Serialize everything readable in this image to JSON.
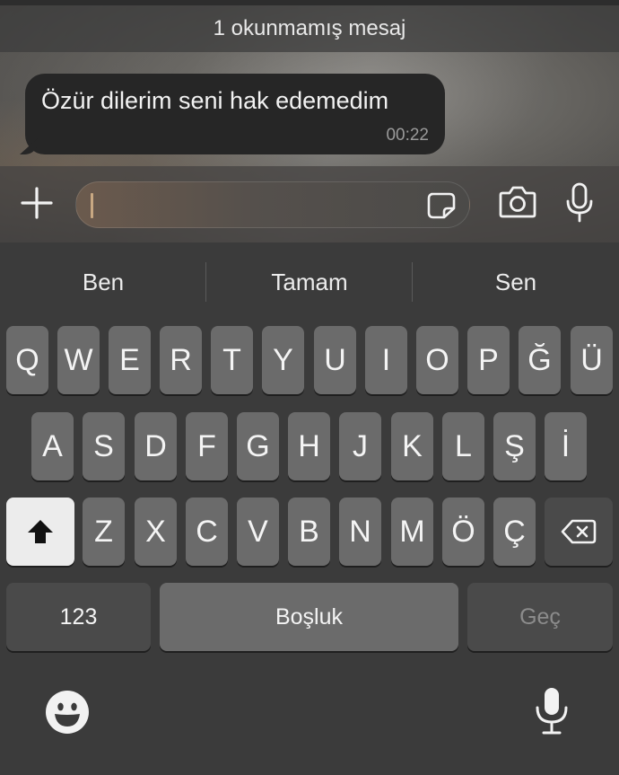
{
  "chat": {
    "unread_banner": "1 okunmamış mesaj",
    "message": {
      "text": "Özür dilerim seni hak edemedim",
      "time": "00:22"
    }
  },
  "composer": {
    "plus_icon": "plus-icon",
    "sticker_icon": "sticker-icon",
    "camera_icon": "camera-icon",
    "mic_icon": "microphone-icon",
    "input_value": ""
  },
  "keyboard": {
    "suggestions": [
      "Ben",
      "Tamam",
      "Sen"
    ],
    "row1": [
      "Q",
      "W",
      "E",
      "R",
      "T",
      "Y",
      "U",
      "I",
      "O",
      "P",
      "Ğ",
      "Ü"
    ],
    "row2": [
      "A",
      "S",
      "D",
      "F",
      "G",
      "H",
      "J",
      "K",
      "L",
      "Ş",
      "İ"
    ],
    "row3": [
      "Z",
      "X",
      "C",
      "V",
      "B",
      "N",
      "M",
      "Ö",
      "Ç"
    ],
    "numbers_label": "123",
    "space_label": "Boşluk",
    "return_label": "Geç",
    "shift_icon": "shift-icon",
    "backspace_icon": "backspace-icon",
    "emoji_icon": "emoji-icon",
    "dictation_icon": "microphone-icon"
  },
  "colors": {
    "keyboard_bg": "#3b3b3b",
    "key_bg": "#6b6b6b",
    "key_dark_bg": "#4a4a4a",
    "shift_active_bg": "#ececec",
    "bubble_bg": "#262626",
    "caret": "#c8a882"
  }
}
